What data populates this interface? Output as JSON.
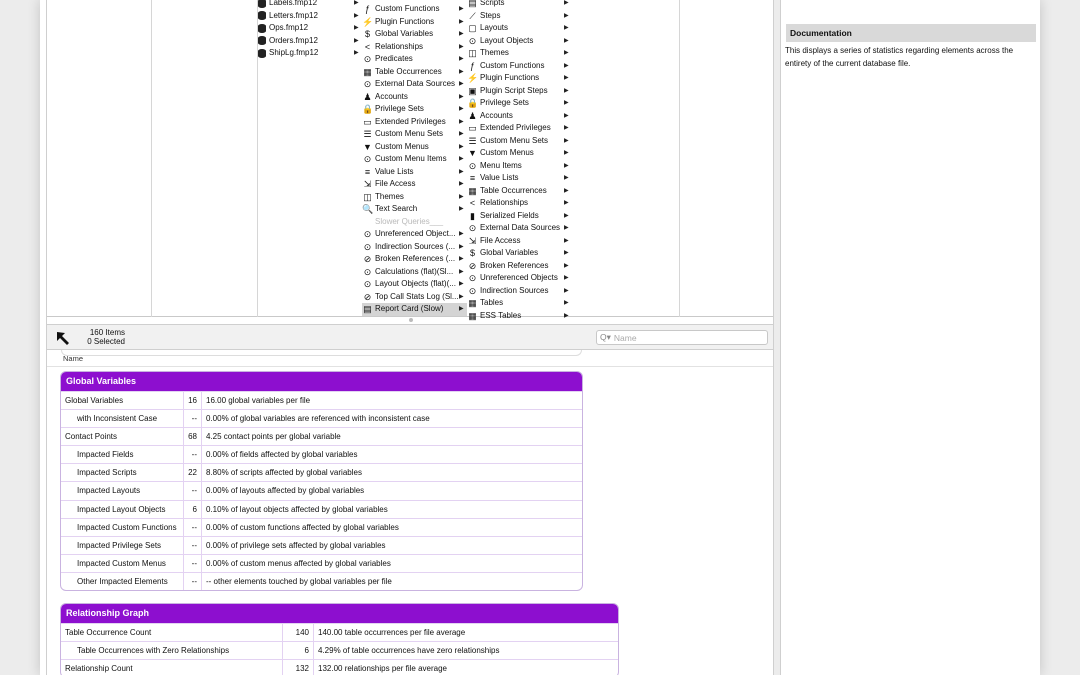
{
  "files": [
    "Labels.fmp12",
    "Letters.fmp12",
    "Ops.fmp12",
    "Orders.fmp12",
    "ShipLg.fmp12"
  ],
  "col3": [
    {
      "label": "Custom Functions",
      "icon": "function-icon",
      "glyph": "ƒ",
      "arrow": true
    },
    {
      "label": "Plugin Functions",
      "icon": "plugin-icon",
      "glyph": "⚡",
      "arrow": true
    },
    {
      "label": "Global Variables",
      "icon": "dollar-icon",
      "glyph": "$",
      "arrow": true
    },
    {
      "label": "Relationships",
      "icon": "relationship-icon",
      "glyph": "<",
      "arrow": true
    },
    {
      "label": "Predicates",
      "icon": "circle-arrow-icon",
      "glyph": "⊙",
      "arrow": true
    },
    {
      "label": "Table Occurrences",
      "icon": "table-occurrence-icon",
      "glyph": "▦",
      "arrow": true
    },
    {
      "label": "External Data Sources",
      "icon": "circle-arrow-icon",
      "glyph": "⊙",
      "arrow": true
    },
    {
      "label": "Accounts",
      "icon": "person-icon",
      "glyph": "♟",
      "arrow": true
    },
    {
      "label": "Privilege Sets",
      "icon": "lock-icon",
      "glyph": "🔒",
      "arrow": true
    },
    {
      "label": "Extended Privileges",
      "icon": "extended-privilege-icon",
      "glyph": "▭",
      "arrow": true
    },
    {
      "label": "Custom Menu Sets",
      "icon": "menu-set-icon",
      "glyph": "☰",
      "arrow": true
    },
    {
      "label": "Custom Menus",
      "icon": "menu-icon",
      "glyph": "▼",
      "arrow": true
    },
    {
      "label": "Custom Menu Items",
      "icon": "circle-arrow-icon",
      "glyph": "⊙",
      "arrow": true
    },
    {
      "label": "Value Lists",
      "icon": "list-icon",
      "glyph": "≡",
      "arrow": true
    },
    {
      "label": "File Access",
      "icon": "file-access-icon",
      "glyph": "⇲",
      "arrow": true
    },
    {
      "label": "Themes",
      "icon": "theme-icon",
      "glyph": "◫",
      "arrow": true
    },
    {
      "label": "Text Search",
      "icon": "magnifier-icon",
      "glyph": "🔍",
      "arrow": true
    },
    {
      "label": "Slower Queries___",
      "icon": "",
      "glyph": "",
      "arrow": false,
      "disabled": true
    },
    {
      "label": "Unreferenced Object...",
      "icon": "circle-arrow-icon",
      "glyph": "⊙",
      "arrow": true
    },
    {
      "label": "Indirection Sources (...",
      "icon": "circle-arrow-icon",
      "glyph": "⊙",
      "arrow": true
    },
    {
      "label": "Broken References (...",
      "icon": "broken-reference-icon",
      "glyph": "⊘",
      "arrow": true
    },
    {
      "label": "Calculations (flat)(Sl...",
      "icon": "circle-arrow-icon",
      "glyph": "⊙",
      "arrow": true
    },
    {
      "label": "Layout Objects (flat)(...",
      "icon": "circle-arrow-icon",
      "glyph": "⊙",
      "arrow": true
    },
    {
      "label": "Top Call Stats Log (Sl...",
      "icon": "stats-icon",
      "glyph": "⊘",
      "arrow": true
    },
    {
      "label": "Report Card (Slow)",
      "icon": "report-card-icon",
      "glyph": "▤",
      "arrow": true,
      "selected": true
    }
  ],
  "col4": [
    {
      "label": "Scripts",
      "icon": "script-icon",
      "glyph": "▤"
    },
    {
      "label": "Steps",
      "icon": "steps-icon",
      "glyph": "⟋"
    },
    {
      "label": "Layouts",
      "icon": "layout-icon",
      "glyph": "▢"
    },
    {
      "label": "Layout Objects",
      "icon": "circle-arrow-icon",
      "glyph": "⊙"
    },
    {
      "label": "Themes",
      "icon": "theme-icon",
      "glyph": "◫"
    },
    {
      "label": "Custom Functions",
      "icon": "function-icon",
      "glyph": "ƒ"
    },
    {
      "label": "Plugin Functions",
      "icon": "plugin-icon",
      "glyph": "⚡"
    },
    {
      "label": "Plugin Script Steps",
      "icon": "plugin-step-icon",
      "glyph": "▣"
    },
    {
      "label": "Privilege Sets",
      "icon": "lock-icon",
      "glyph": "🔒"
    },
    {
      "label": "Accounts",
      "icon": "person-icon",
      "glyph": "♟"
    },
    {
      "label": "Extended Privileges",
      "icon": "extended-privilege-icon",
      "glyph": "▭"
    },
    {
      "label": "Custom Menu Sets",
      "icon": "menu-set-icon",
      "glyph": "☰"
    },
    {
      "label": "Custom Menus",
      "icon": "menu-icon",
      "glyph": "▼"
    },
    {
      "label": "Menu Items",
      "icon": "circle-arrow-icon",
      "glyph": "⊙"
    },
    {
      "label": "Value Lists",
      "icon": "list-icon",
      "glyph": "≡"
    },
    {
      "label": "Table Occurrences",
      "icon": "table-occurrence-icon",
      "glyph": "▦"
    },
    {
      "label": "Relationships",
      "icon": "relationship-icon",
      "glyph": "<"
    },
    {
      "label": "Serialized Fields",
      "icon": "serialized-field-icon",
      "glyph": "▮"
    },
    {
      "label": "External Data Sources",
      "icon": "circle-arrow-icon",
      "glyph": "⊙"
    },
    {
      "label": "File Access",
      "icon": "file-access-icon",
      "glyph": "⇲"
    },
    {
      "label": "Global Variables",
      "icon": "dollar-icon",
      "glyph": "$"
    },
    {
      "label": "Broken References",
      "icon": "broken-reference-icon",
      "glyph": "⊘"
    },
    {
      "label": "Unreferenced Objects",
      "icon": "circle-arrow-icon",
      "glyph": "⊙"
    },
    {
      "label": "Indirection Sources",
      "icon": "circle-arrow-icon",
      "glyph": "⊙"
    },
    {
      "label": "Tables",
      "icon": "table-icon",
      "glyph": "▦"
    },
    {
      "label": "ESS Tables",
      "icon": "table-icon",
      "glyph": "▦"
    }
  ],
  "status": {
    "items": "160 Items",
    "selected": "0 Selected"
  },
  "search": {
    "placeholder": "Name"
  },
  "clipped": {
    "name_label": "Name"
  },
  "global_variables": {
    "title": "Global Variables",
    "rows": [
      {
        "label": "Global Variables",
        "indent": false,
        "value": "16",
        "desc": "16.00 global variables per file"
      },
      {
        "label": "with Inconsistent Case",
        "indent": true,
        "value": "--",
        "desc": "0.00% of global variables are referenced with inconsistent case"
      },
      {
        "label": "Contact Points",
        "indent": false,
        "value": "68",
        "desc": "4.25 contact points per global variable"
      },
      {
        "label": "Impacted Fields",
        "indent": true,
        "value": "--",
        "desc": "0.00% of fields affected by global variables"
      },
      {
        "label": "Impacted Scripts",
        "indent": true,
        "value": "22",
        "desc": "8.80% of scripts affected by global variables"
      },
      {
        "label": "Impacted Layouts",
        "indent": true,
        "value": "--",
        "desc": "0.00% of layouts affected by global variables"
      },
      {
        "label": "Impacted Layout Objects",
        "indent": true,
        "value": "6",
        "desc": "0.10% of layout objects affected by global variables"
      },
      {
        "label": "Impacted Custom Functions",
        "indent": true,
        "value": "--",
        "desc": "0.00% of custom functions affected by global variables"
      },
      {
        "label": "Impacted Privilege Sets",
        "indent": true,
        "value": "--",
        "desc": "0.00% of privilege sets affected by global variables"
      },
      {
        "label": "Impacted Custom Menus",
        "indent": true,
        "value": "--",
        "desc": "0.00% of custom menus affected by global variables"
      },
      {
        "label": "Other Impacted Elements",
        "indent": true,
        "value": "--",
        "desc": "-- other elements touched by global variables per file"
      }
    ]
  },
  "relationship_graph": {
    "title": "Relationship Graph",
    "rows": [
      {
        "label": "Table Occurrence Count",
        "indent": false,
        "value": "140",
        "desc": "140.00 table occurrences per file average"
      },
      {
        "label": "Table Occurrences with Zero Relationships",
        "indent": true,
        "value": "6",
        "desc": "4.29% of table occurrences have zero relationships"
      },
      {
        "label": "Relationship Count",
        "indent": false,
        "value": "132",
        "desc": "132.00 relationships per file average"
      }
    ]
  },
  "documentation": {
    "title": "Documentation",
    "text": "This displays a series of statistics regarding elements across the entirety of the current database file."
  },
  "colors": {
    "accent": "#8d0fcf"
  }
}
